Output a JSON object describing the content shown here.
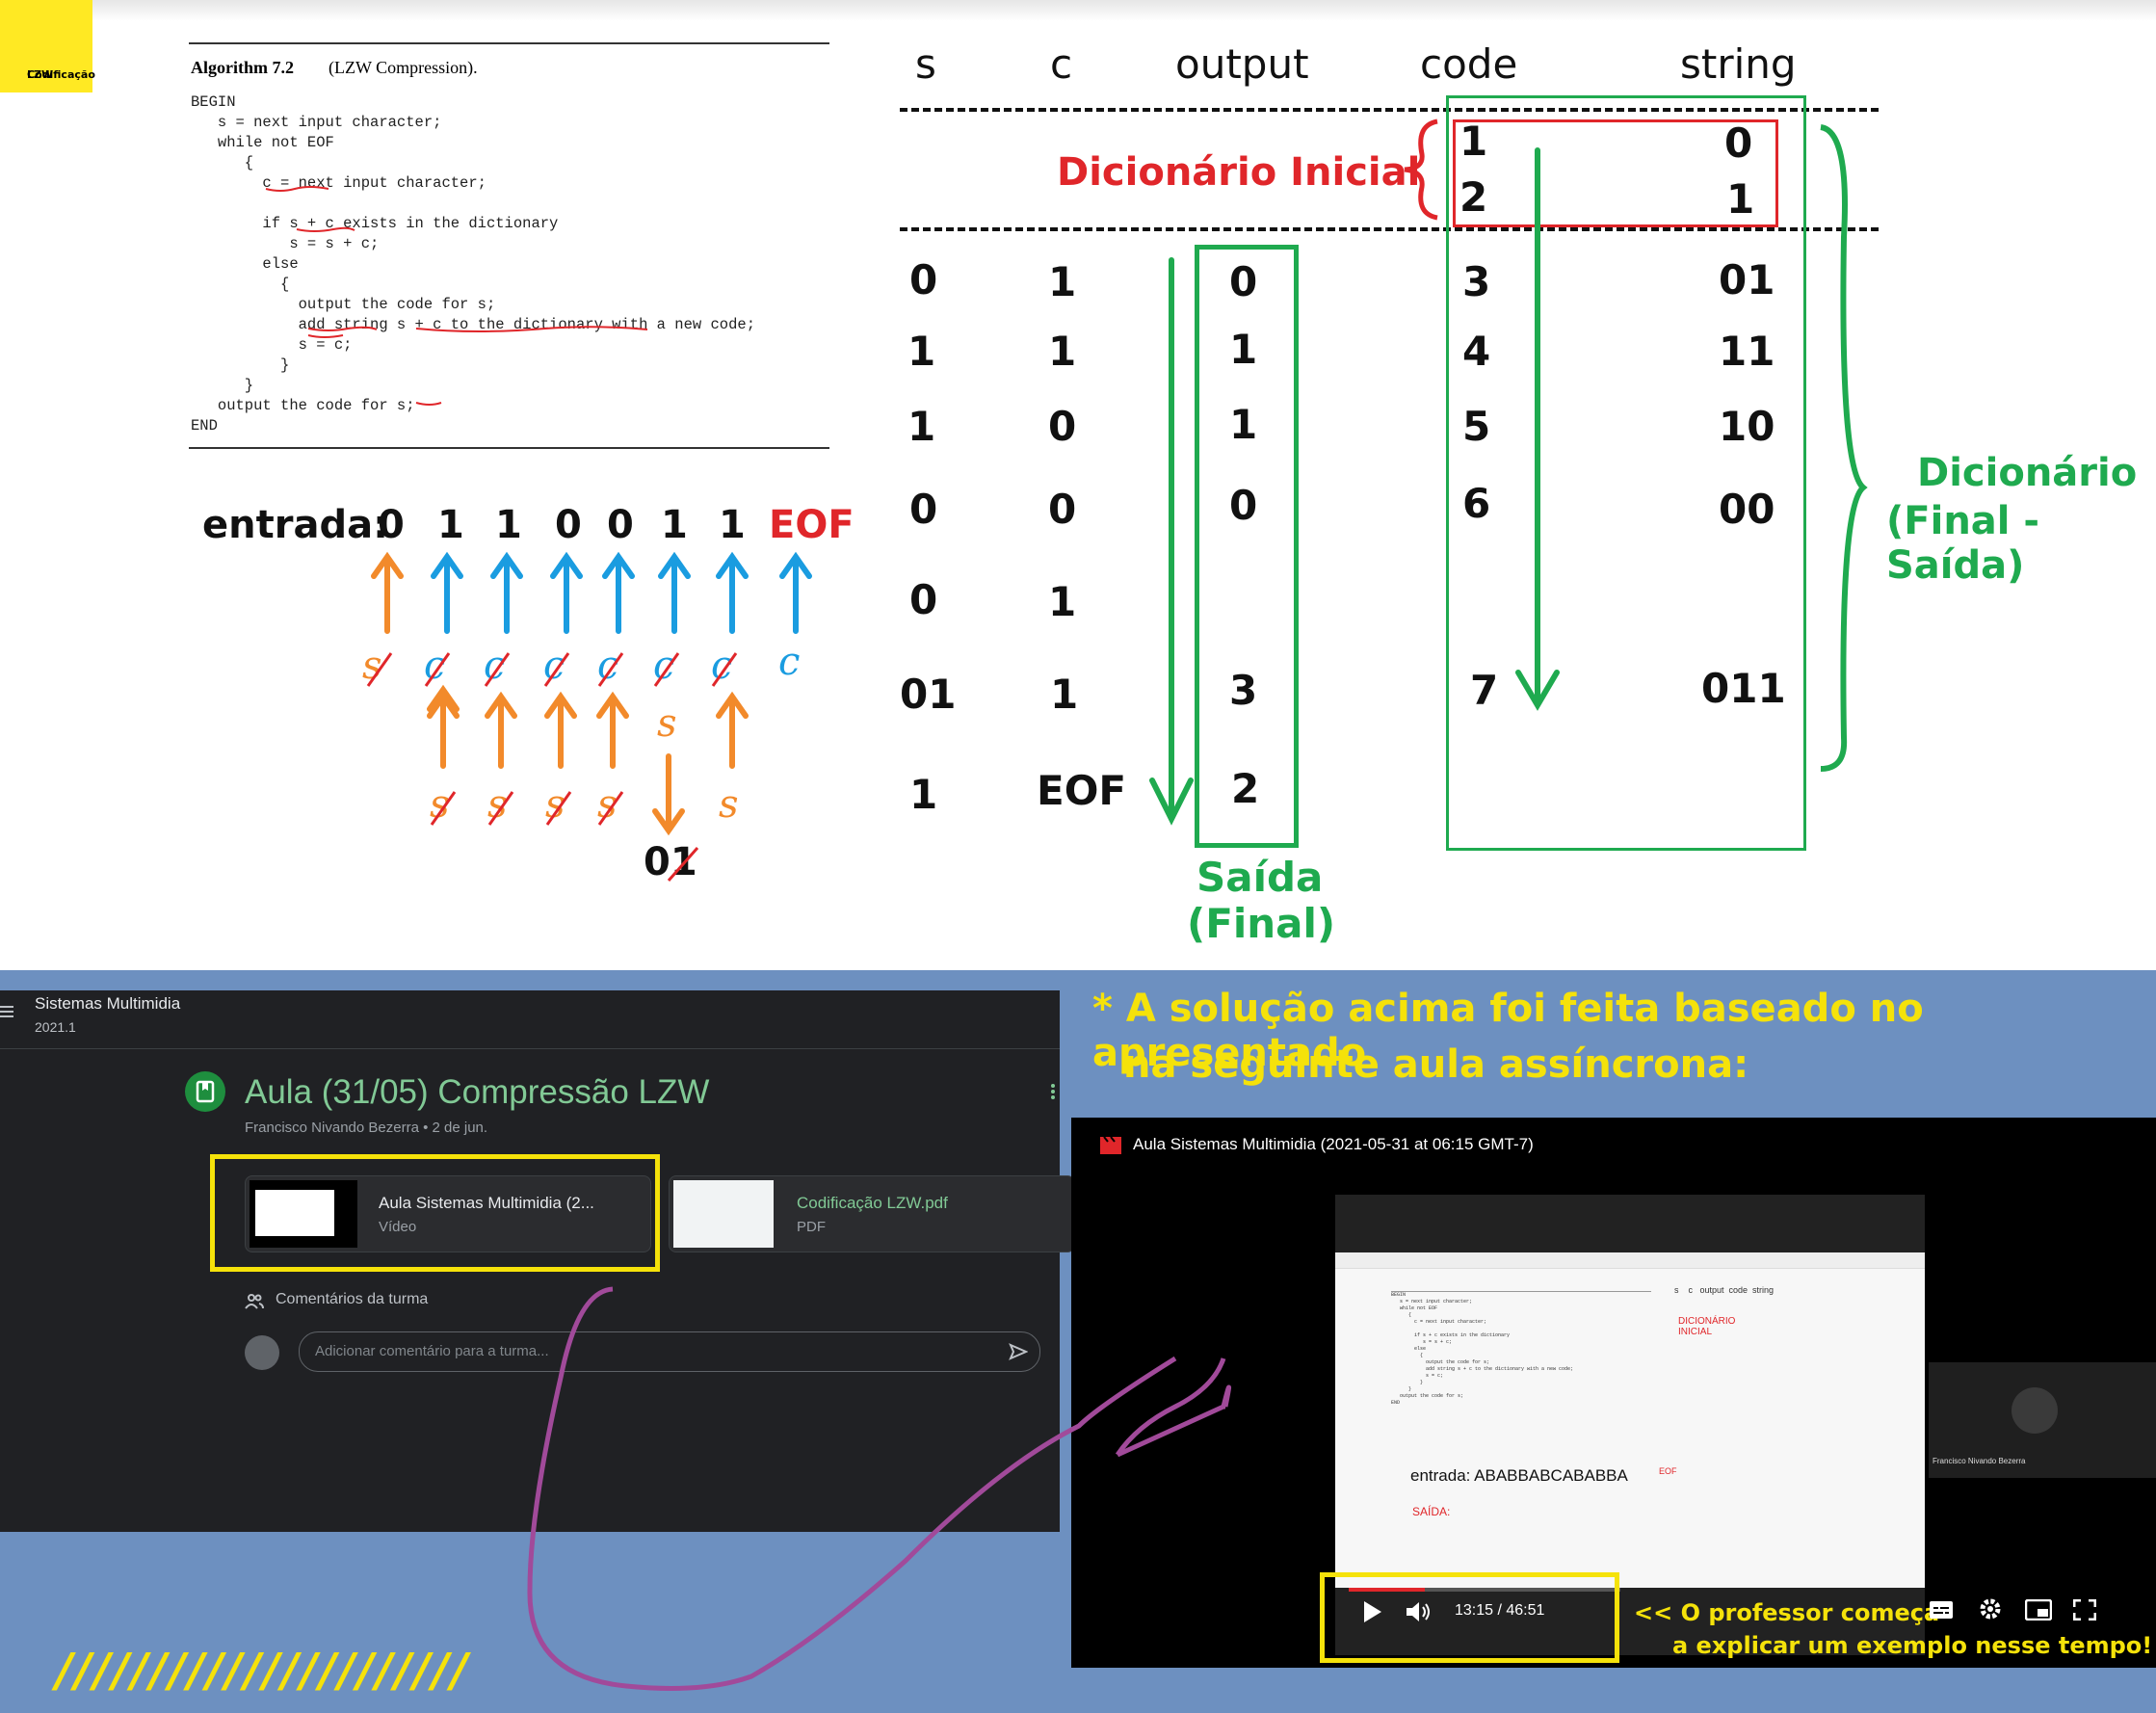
{
  "corner_tag": {
    "line1": "Codificação",
    "line2": "LZW"
  },
  "algorithm": {
    "title": "Algorithm 7.2",
    "subtitle": "(LZW Compression).",
    "code": "BEGIN\n   s = next input character;\n   while not EOF\n      {\n        c = next input character;\n\n        if s + c exists in the dictionary\n           s = s + c;\n        else\n          {\n            output the code for s;\n            add string s + c to the dictionary with a new code;\n            s = c;\n          }\n      }\n   output the code for s;\nEND"
  },
  "entrada": {
    "label": "entrada:",
    "symbols": [
      "0",
      "1",
      "1",
      "0",
      "0",
      "1",
      "1"
    ],
    "eof": "EOF",
    "c_mark": "c",
    "s_mark": "s",
    "crossed_label": "01"
  },
  "table": {
    "headers": [
      "s",
      "c",
      "output",
      "code",
      "string"
    ],
    "initial_dictionary_label": "Dicionário Inicial",
    "initial": [
      {
        "code": "1",
        "string": "0"
      },
      {
        "code": "2",
        "string": "1"
      }
    ],
    "rows": [
      {
        "s": "0",
        "c": "1",
        "output": "0",
        "code": "3",
        "string": "01"
      },
      {
        "s": "1",
        "c": "1",
        "output": "1",
        "code": "4",
        "string": "11"
      },
      {
        "s": "1",
        "c": "0",
        "output": "1",
        "code": "5",
        "string": "10"
      },
      {
        "s": "0",
        "c": "0",
        "output": "0",
        "code": "6",
        "string": "00"
      },
      {
        "s": "0",
        "c": "1",
        "output": "",
        "code": "",
        "string": ""
      },
      {
        "s": "01",
        "c": "1",
        "output": "3",
        "code": "7",
        "string": "011"
      },
      {
        "s": "1",
        "c": "EOF",
        "output": "2",
        "code": "",
        "string": ""
      }
    ],
    "saida_label_1": "Saída",
    "saida_label_2": "(Final)",
    "dict_label_1": "Dicionário",
    "dict_label_2": "(Final - Saída)"
  },
  "classroom": {
    "course": "Sistemas Multimidia",
    "term": "2021.1",
    "post_title": "Aula (31/05) Compressão LZW",
    "post_meta": "Francisco Nivando Bezerra • 2 de jun.",
    "attachments": [
      {
        "title": "Aula Sistemas Multimidia (2...",
        "type": "Vídeo"
      },
      {
        "title": "Codificação LZW.pdf",
        "type": "PDF"
      }
    ],
    "comments_label": "Comentários da turma",
    "comment_placeholder": "Adicionar comentário para a turma..."
  },
  "note": {
    "line1": "* A solução acima foi feita baseado no apresentado",
    "line2": "na seguinte aula assíncrona:"
  },
  "video": {
    "title": "Aula Sistemas Multimidia (2021-05-31 at 06:15 GMT-7)",
    "time": "13:15 / 46:51",
    "progress": 0.28,
    "presenter": "Francisco Nivando Bezerra",
    "inner_entrada": "entrada: ABABBABCABABBA",
    "inner_eof": "EOF",
    "inner_saida": "SAÍDA:",
    "inner_dict": "DICIONÁRIO INICIAL",
    "inner_headers": "s    c   output  code  string"
  },
  "callout": {
    "line1": "<< O professor começa",
    "line2": "a explicar um exemplo nesse tempo!"
  },
  "slashes": "//////////////////////",
  "colors": {
    "red": "#e0262a",
    "green": "#1faa4f",
    "orange": "#f28a2b",
    "blue": "#1a9ce0",
    "yellow": "#f5e20a",
    "purple": "#a14a9a"
  }
}
